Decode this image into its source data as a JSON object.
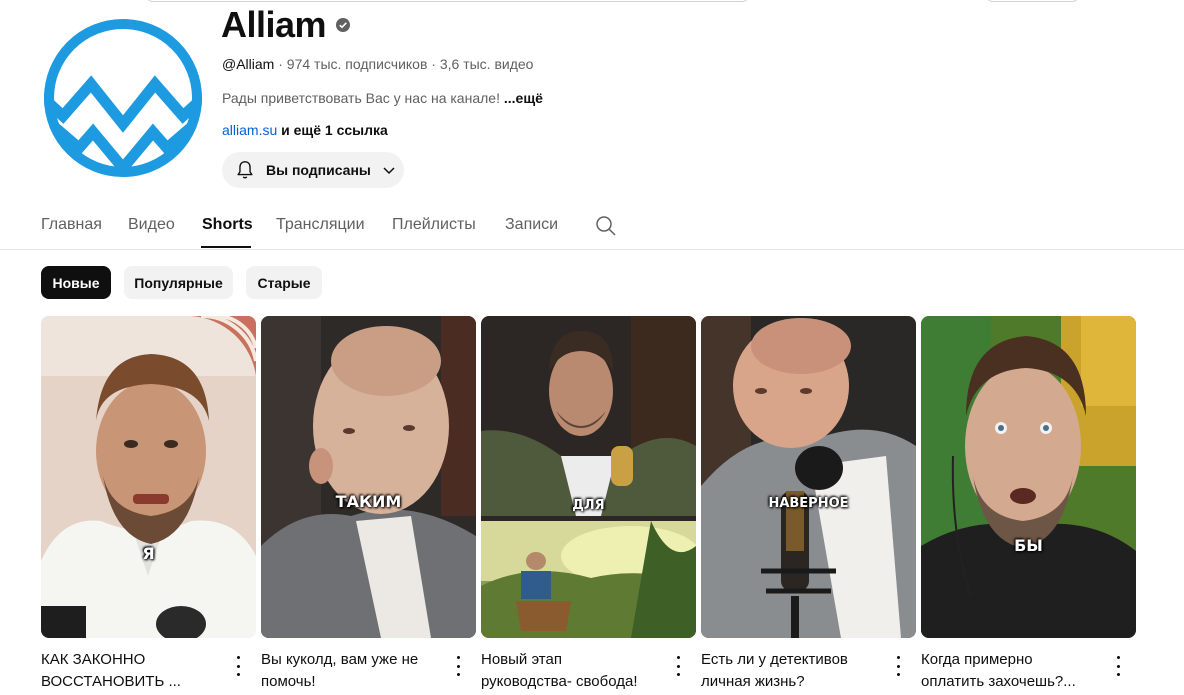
{
  "channel": {
    "name": "Alliam",
    "handle": "@Alliam",
    "subscribers": "974 тыс. подписчиков",
    "videos": "3,6 тыс. видео",
    "separator": "·",
    "description": "Рады приветствовать Вас у нас на канале!",
    "description_more": "...ещё",
    "link": "alliam.su",
    "link_more": "и ещё 1 ссылка",
    "subscribed_label": "Вы подписаны",
    "brand_color": "#1e9be0"
  },
  "tabs": [
    "Главная",
    "Видео",
    "Shorts",
    "Трансляции",
    "Плейлисты",
    "Записи"
  ],
  "active_tab": "Shorts",
  "chips": [
    "Новые",
    "Популярные",
    "Старые"
  ],
  "active_chip": "Новые",
  "shorts": [
    {
      "caption": "Я",
      "title_line1": "КАК ЗАКОННО",
      "title_line2": "ВОССТАНОВИТЬ ..."
    },
    {
      "caption": "ТАКИМ",
      "title_line1": "Вы куколд, вам уже не",
      "title_line2": "помочь!"
    },
    {
      "caption": "ДЛЯ",
      "title_line1": "Новый этап",
      "title_line2": "руководства- свобода!"
    },
    {
      "caption": "НАВЕРНОЕ",
      "title_line1": "Есть ли у детективов",
      "title_line2": "личная жизнь?"
    },
    {
      "caption": "БЫ",
      "title_line1": "Когда примерно",
      "title_line2": "оплатить захочешь?..."
    }
  ]
}
